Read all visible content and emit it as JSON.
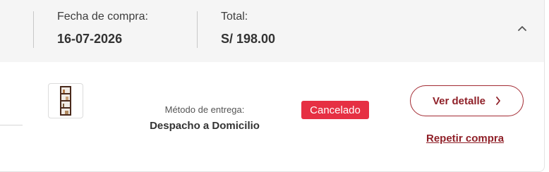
{
  "order": {
    "purchase_date_label": "Fecha de compra:",
    "purchase_date": "16-07-2026",
    "total_label": "Total:",
    "total": "S/ 198.00"
  },
  "delivery": {
    "method_label": "Método de entrega:",
    "method": "Despacho a Domicilio"
  },
  "status": {
    "label": "Cancelado",
    "color": "#e63043"
  },
  "actions": {
    "view_detail": "Ver detalle",
    "repeat_purchase": "Repetir compra"
  },
  "colors": {
    "accent": "#8f2028",
    "summary_bg": "#f5f5f5"
  },
  "icons": {
    "collapse": "chevron-up-icon",
    "detail": "chevron-right-icon",
    "product": "bookshelf-product-image"
  }
}
